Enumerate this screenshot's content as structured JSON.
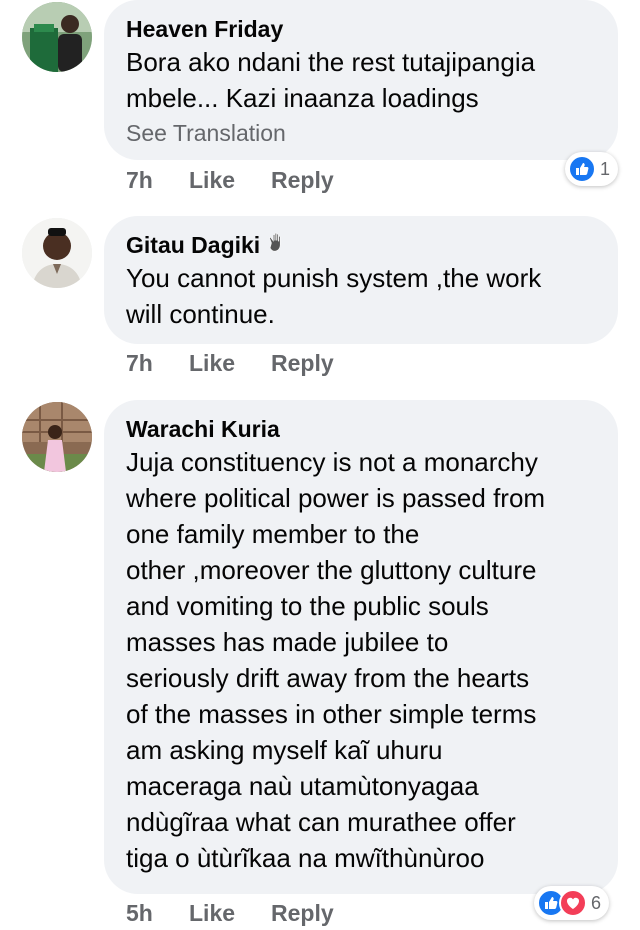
{
  "comments": [
    {
      "name": "Heaven Friday",
      "text_lines": [
        "Bora ako ndani the rest tutajipangia",
        "mbele... Kazi inaanza loadings"
      ],
      "see_translation": "See Translation",
      "time": "7h",
      "like": "Like",
      "reply": "Reply",
      "reaction_count": "1",
      "reactions": [
        "like-icon"
      ]
    },
    {
      "name": "Gitau Dagiki",
      "badge": "waving-hand-icon",
      "text_lines": [
        "You cannot punish system ,the work",
        "will continue."
      ],
      "time": "7h",
      "like": "Like",
      "reply": "Reply"
    },
    {
      "name": "Warachi Kuria",
      "text_lines": [
        "Juja constituency is not a monarchy",
        "where political power is passed from",
        "one family member to the",
        "other ,moreover the gluttony culture",
        "and vomiting to the public souls",
        "masses has made jubilee to",
        "seriously drift away from the hearts",
        "of the masses in other simple terms",
        "am asking myself kaĩ uhuru",
        "maceraga naù utamùtonyagaa",
        "ndùgĩraa what can murathee offer",
        "tiga o ùtùrĩkaa na mwĩthùnùroo"
      ],
      "time": "5h",
      "like": "Like",
      "reply": "Reply",
      "reaction_count": "6",
      "reactions": [
        "like-icon",
        "love-icon"
      ]
    }
  ],
  "colors": {
    "bubble": "#f0f2f5",
    "secondary_text": "#65676b",
    "like_blue": "#1877f2",
    "love_red": "#f33e58"
  }
}
